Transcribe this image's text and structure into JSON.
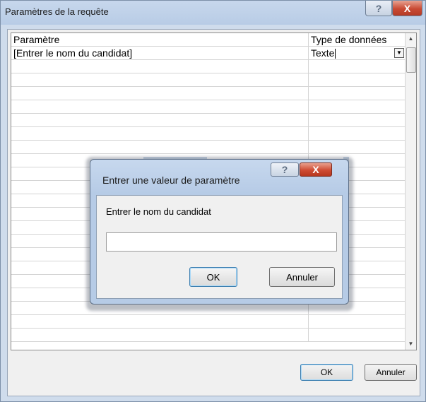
{
  "outer_dialog": {
    "title": "Paramètres de la requête",
    "help_glyph": "?",
    "close_glyph": "X",
    "grid": {
      "headers": {
        "param": "Paramètre",
        "type": "Type de données"
      },
      "rows": [
        {
          "param": "[Entrer le nom du candidat]",
          "type": "Texte"
        }
      ]
    },
    "ok_label": "OK",
    "cancel_label": "Annuler"
  },
  "inner_dialog": {
    "title": "Entrer une valeur de paramètre",
    "help_glyph": "?",
    "close_glyph": "X",
    "prompt": "Entrer le nom du candidat",
    "input_value": "",
    "ok_label": "OK",
    "cancel_label": "Annuler"
  },
  "icons": {
    "select_arrow": "▼",
    "scroll_up": "▲",
    "scroll_down": "▼"
  }
}
